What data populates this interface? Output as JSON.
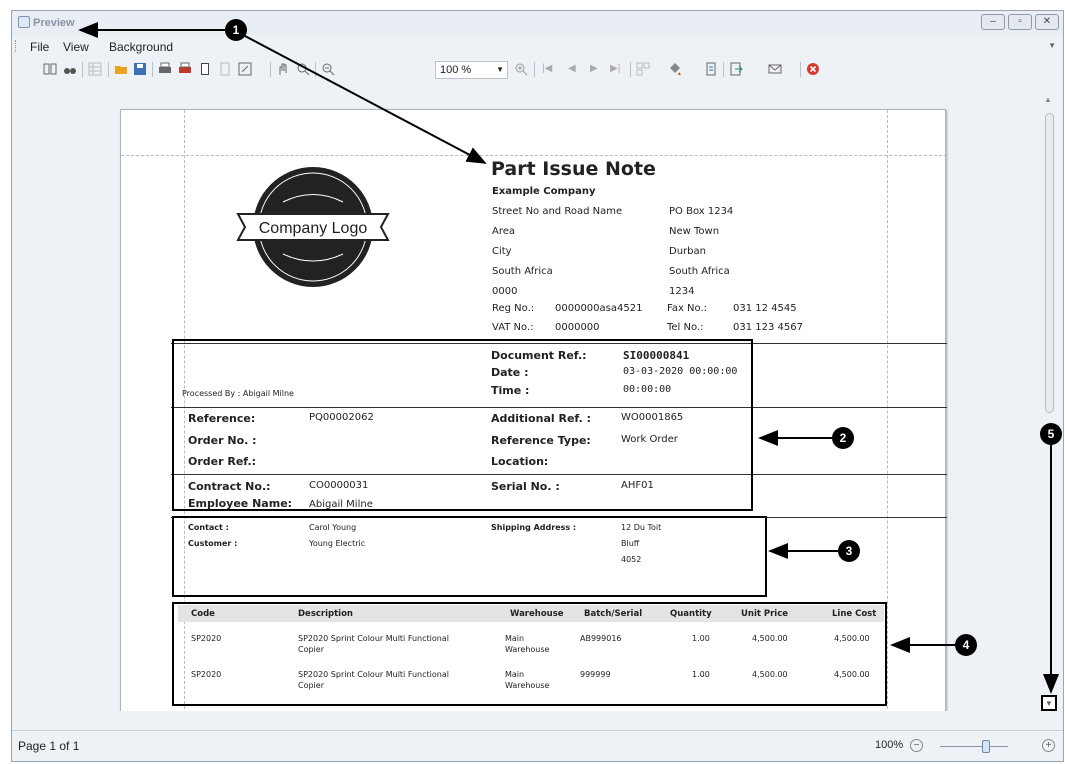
{
  "window": {
    "title": "Preview",
    "min": "–",
    "max": "▫",
    "close": "✕"
  },
  "menu": [
    "File",
    "View",
    "Background"
  ],
  "toolbar": {
    "zoom": "100 %"
  },
  "doc": {
    "title": "Part Issue Note",
    "logo_text": "Company Logo",
    "company": "Example Company",
    "addr_left": [
      "Street No and Road Name",
      "Area",
      "City",
      "South Africa",
      "0000"
    ],
    "addr_right": [
      "PO Box 1234",
      "New Town",
      "Durban",
      "South Africa",
      "1234"
    ],
    "reg_label": "Reg No.:",
    "reg_value": "0000000asa4521",
    "fax_label": "Fax No.:",
    "fax_value": "031 12 4545",
    "vat_label": "VAT No.:",
    "vat_value": "0000000",
    "tel_label": "Tel No.:",
    "tel_value": "031 123 4567",
    "docref_label": "Document Ref.:",
    "docref_value": "SI00000841",
    "date_label": "Date :",
    "date_value": "03-03-2020 00:00:00",
    "time_label": "Time :",
    "time_value": "00:00:00",
    "processed_by": "Processed By : Abigail Milne",
    "reference_label": "Reference:",
    "reference_value": "PQ00002062",
    "order_no_label": "Order No. :",
    "order_ref_label": "Order Ref.:",
    "addref_label": "Additional Ref. :",
    "addref_value": "WO0001865",
    "reftype_label": "Reference Type:",
    "reftype_value": "Work Order",
    "location_label": "Location:",
    "contract_label": "Contract No.:",
    "contract_value": "CO0000031",
    "employee_label": "Employee Name:",
    "employee_value": "Abigail Milne",
    "serial_label": "Serial No. :",
    "serial_value": "AHF01",
    "contact_label": "Contact :",
    "contact_value": "Carol Young",
    "customer_label": "Customer :",
    "customer_value": "Young Electric",
    "ship_label": "Shipping Address :",
    "ship_lines": [
      "12 Du Toit",
      "Bluff",
      "4052"
    ],
    "table_headers": [
      "Code",
      "Description",
      "Warehouse",
      "Batch/Serial",
      "Quantity",
      "Unit Price",
      "Line Cost"
    ],
    "rows": [
      {
        "code": "SP2020",
        "desc1": "SP2020 Sprint Colour Multi Functional",
        "desc2": "Copier",
        "wh1": "Main",
        "wh2": "Warehouse",
        "batch": "AB999016",
        "qty": "1.00",
        "price": "4,500.00",
        "cost": "4,500.00"
      },
      {
        "code": "SP2020",
        "desc1": "SP2020 Sprint Colour Multi Functional",
        "desc2": "Copier",
        "wh1": "Main",
        "wh2": "Warehouse",
        "batch": "999999",
        "qty": "1.00",
        "price": "4,500.00",
        "cost": "4,500.00"
      }
    ]
  },
  "status": {
    "page": "Page 1 of 1",
    "zoom": "100%"
  },
  "callouts": [
    "1",
    "2",
    "3",
    "4",
    "5"
  ]
}
